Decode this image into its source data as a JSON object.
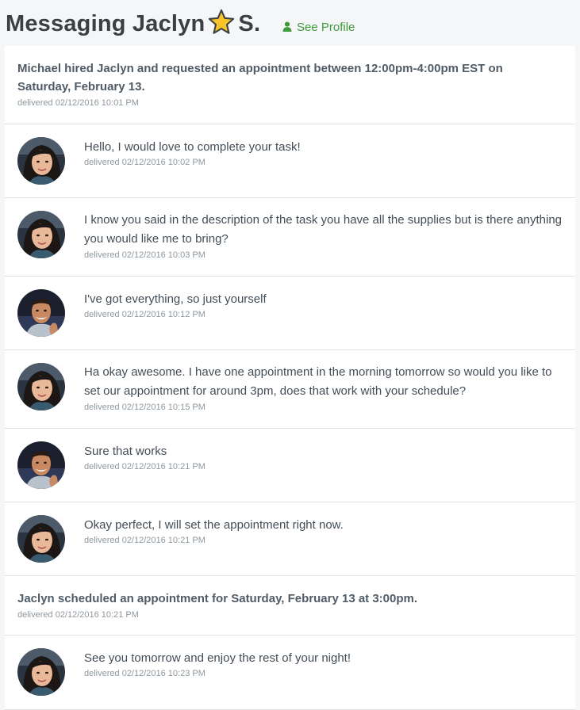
{
  "header": {
    "title_prefix": "Messaging Jaclyn",
    "title_suffix": "S.",
    "star_icon": "star-icon",
    "see_profile_label": "See Profile",
    "profile_icon": "person-icon",
    "link_color": "#3e9a3c",
    "star_color": "#f7c52a"
  },
  "messages": [
    {
      "kind": "system",
      "text": "Michael hired Jaclyn and requested an appointment between 12:00pm-4:00pm EST on Saturday, February 13.",
      "timestamp": "delivered 02/12/2016 10:01 PM"
    },
    {
      "kind": "message",
      "sender": "Jaclyn",
      "text": "Hello, I would love to complete your task!",
      "timestamp": "delivered 02/12/2016 10:02 PM"
    },
    {
      "kind": "message",
      "sender": "Jaclyn",
      "text": "I know you said in the description of the task you have all the supplies but is there anything you would like me to bring?",
      "timestamp": "delivered 02/12/2016 10:03 PM"
    },
    {
      "kind": "message",
      "sender": "Michael",
      "text": "I've got everything, so just yourself",
      "timestamp": "delivered 02/12/2016 10:12 PM"
    },
    {
      "kind": "message",
      "sender": "Jaclyn",
      "text": "Ha okay awesome. I have one appointment in the morning tomorrow so would you like to set our appointment for around 3pm, does that work with your schedule?",
      "timestamp": "delivered 02/12/2016 10:15 PM"
    },
    {
      "kind": "message",
      "sender": "Michael",
      "text": "Sure that works",
      "timestamp": "delivered 02/12/2016 10:21 PM"
    },
    {
      "kind": "message",
      "sender": "Jaclyn",
      "text": "Okay perfect, I will set the appointment right now.",
      "timestamp": "delivered 02/12/2016 10:21 PM"
    },
    {
      "kind": "system",
      "text": "Jaclyn scheduled an appointment for Saturday, February 13 at 3:00pm.",
      "timestamp": "delivered 02/12/2016 10:21 PM"
    },
    {
      "kind": "message",
      "sender": "Jaclyn",
      "text": "See you tomorrow and enjoy the rest of your night!",
      "timestamp": "delivered 02/12/2016 10:23 PM"
    }
  ]
}
